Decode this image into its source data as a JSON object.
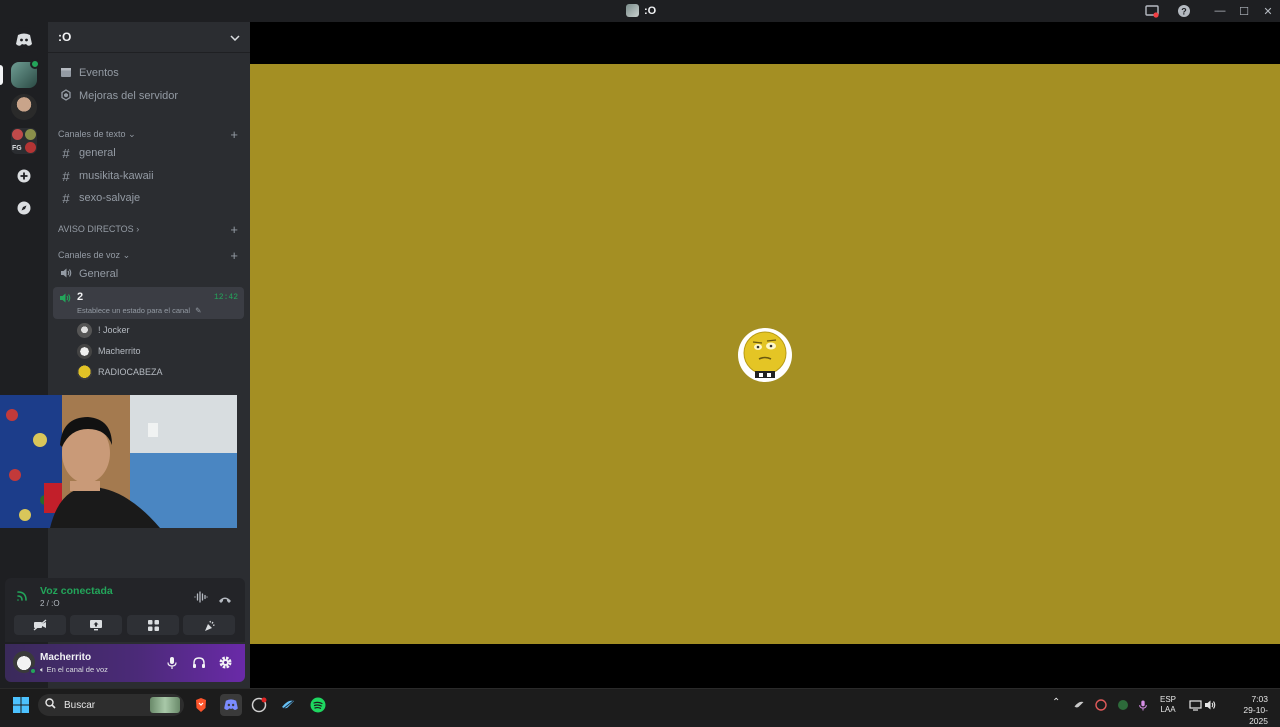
{
  "window": {
    "title": ":O",
    "controls": [
      "—",
      "☐",
      "✕"
    ]
  },
  "sidebar": {
    "server_name": ":O",
    "nav": [
      {
        "label": "Eventos",
        "icon": "calendar-icon"
      },
      {
        "label": "Mejoras del servidor",
        "icon": "boost-icon"
      }
    ],
    "text_category": "Canales de texto",
    "text_channels": [
      "general",
      "musikita-kawaii",
      "sexo-salvaje"
    ],
    "announcements_category": "AVISO DIRECTOS",
    "voice_category": "Canales de voz",
    "voice_channels": [
      {
        "label": "General"
      },
      {
        "label": "2",
        "time": "12:42",
        "status": "Establece un estado para el canal"
      }
    ],
    "voice_users": [
      "! Jocker",
      "Macherrito",
      "RADIOCABEZA"
    ],
    "server_rail_badge": "FG"
  },
  "voice_panel": {
    "status": "Voz conectada",
    "channel": "2 / :O"
  },
  "user_panel": {
    "username": "Macherrito",
    "status": "En el canal de voz"
  },
  "taskbar": {
    "search_placeholder": "Buscar",
    "lang_top": "ESP",
    "lang_bottom": "LAA",
    "time": "7:03",
    "date": "29-10-2025"
  },
  "colors": {
    "video_bg": "#a48f23",
    "speaking_green": "#23a55a",
    "accent_purple": "#5865f2"
  }
}
